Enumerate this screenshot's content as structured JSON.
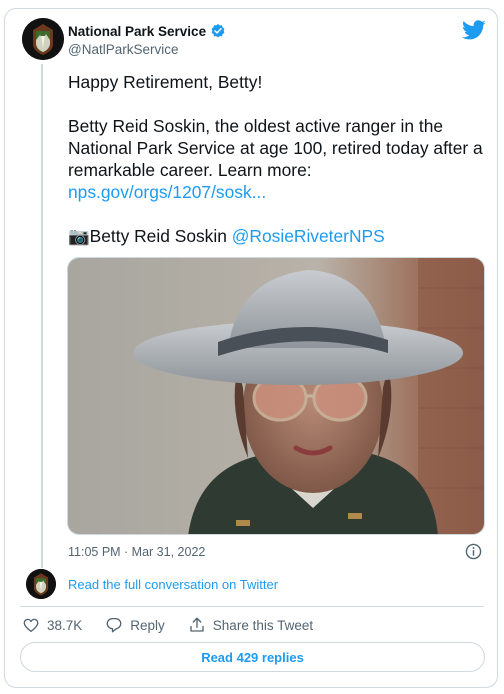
{
  "account": {
    "display_name": "National Park Service",
    "handle": "@NatlParkService",
    "verified": true
  },
  "tweet": {
    "line1": "Happy Retirement, Betty!",
    "line2": "Betty Reid Soskin, the oldest active ranger in the National Park Service at age 100, retired today after a remarkable career. Learn more:",
    "link": "nps.gov/orgs/1207/sosk...",
    "photo_credit_emoji": "📷",
    "photo_credit": "Betty Reid Soskin",
    "mention": "@RosieRiveterNPS"
  },
  "timestamp": "11:05 PM · Mar 31, 2022",
  "read_conversation": "Read the full conversation on Twitter",
  "actions": {
    "likes": "38.7K",
    "reply": "Reply",
    "share": "Share this Tweet"
  },
  "replies_button": "Read 429 replies",
  "colors": {
    "accent": "#1d9bf0",
    "text": "#0f1419",
    "muted": "#536471",
    "border": "#cfd9de"
  },
  "icons": [
    "nps-arrowhead-logo",
    "verified-badge-icon",
    "twitter-bird-icon",
    "info-icon",
    "heart-icon",
    "reply-icon",
    "share-icon"
  ]
}
